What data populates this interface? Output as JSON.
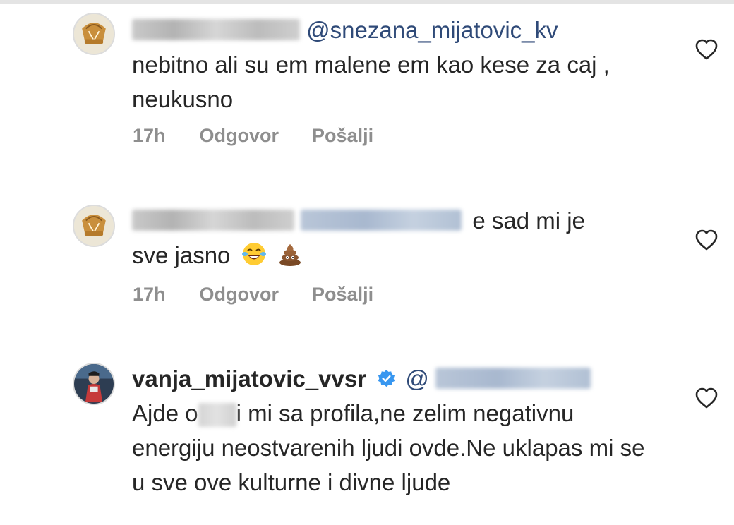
{
  "comments": [
    {
      "mention": "@snezana_mijatovic_kv",
      "text": "nebitno ali su em malene em kao kese za caj , neukusno",
      "time": "17h",
      "reply_label": "Odgovor",
      "send_label": "Pošalji"
    },
    {
      "text_a": "e sad mi je",
      "text_b": "sve jasno",
      "emojis": [
        "laughing-tears-emoji",
        "poop-emoji"
      ],
      "time": "17h",
      "reply_label": "Odgovor",
      "send_label": "Pošalji"
    },
    {
      "username": "vanja_mijatovic_vvsr",
      "mention_prefix": "@",
      "text_a": "Ajde o",
      "text_b": "i mi sa profila,ne zelim negativnu energiju neostvarenih ljudi ovde.Ne uklapas mi se u sve ove kulturne i divne ljude",
      "verified_icon": "verified-badge-icon"
    }
  ],
  "colors": {
    "text": "#262626",
    "meta": "#8e8e8e",
    "mention": "#2f4a78",
    "verified": "#3897f0"
  },
  "icons": {
    "like": "heart-outline-icon"
  }
}
